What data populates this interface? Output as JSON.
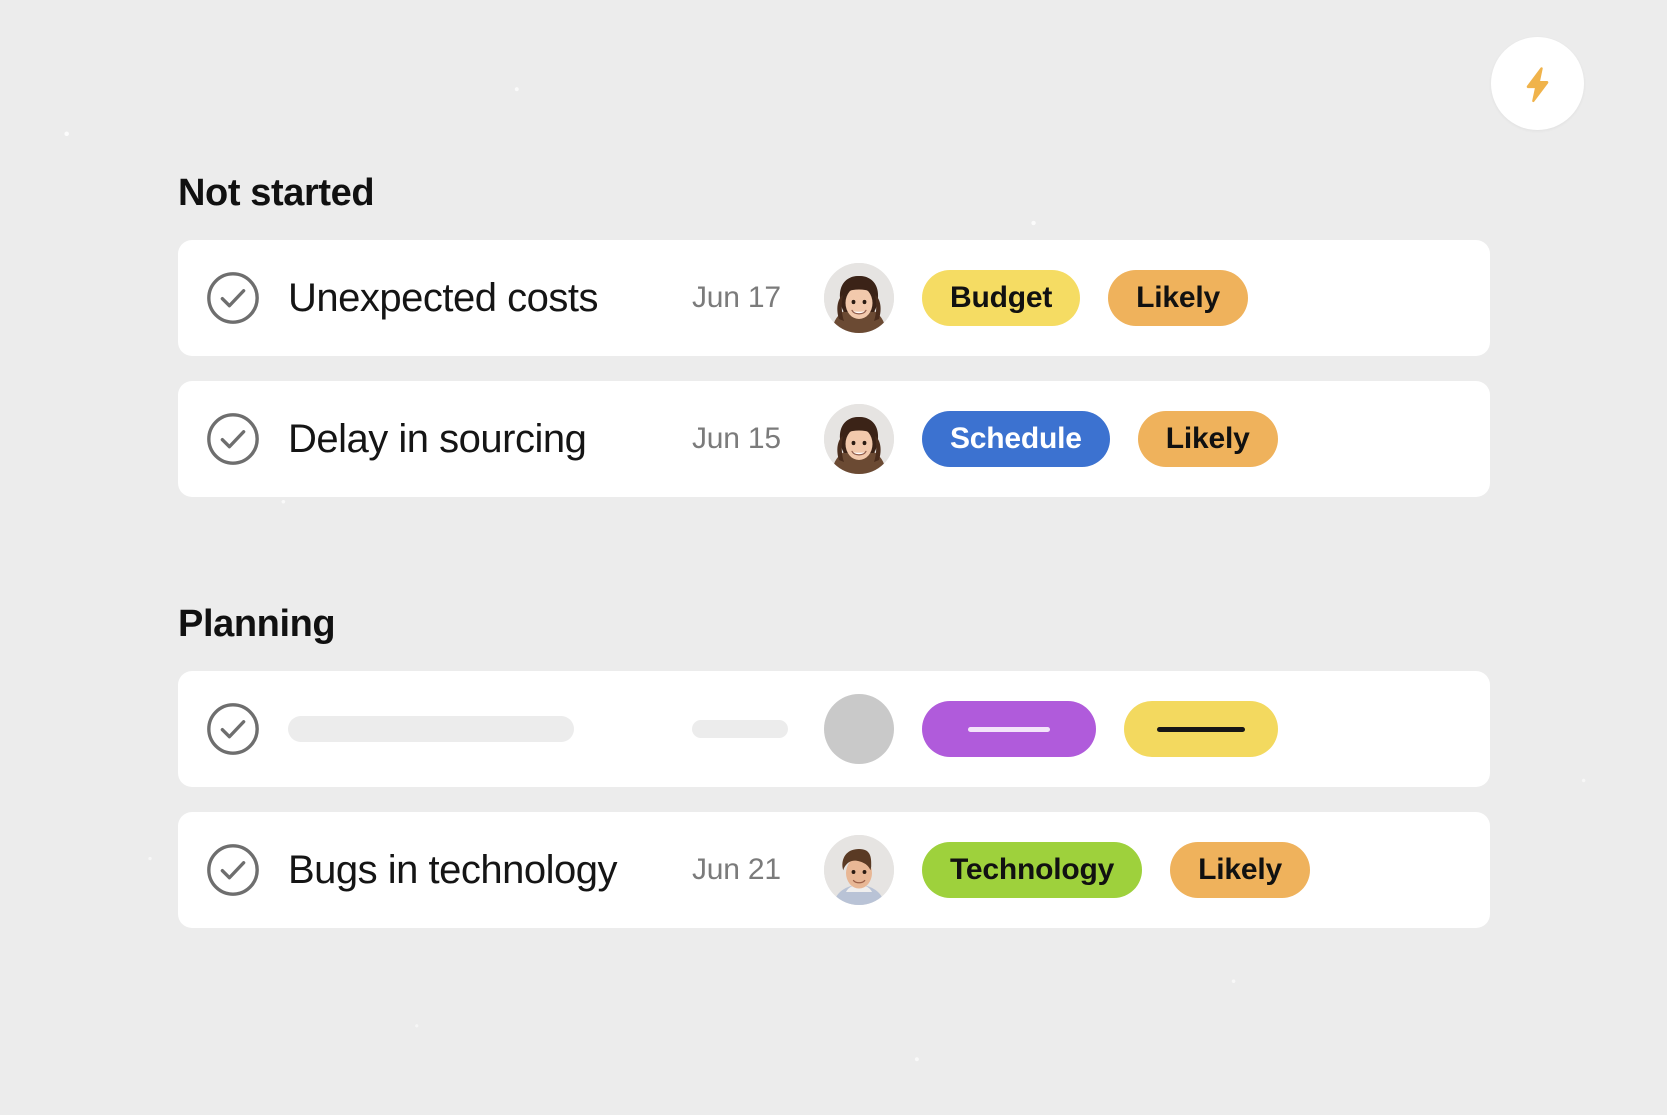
{
  "header": {
    "action_button": {
      "icon": "lightning-bolt-icon",
      "color": "#F0B34B"
    }
  },
  "colors": {
    "page_background": "#ECECEC",
    "card_background": "#FFFFFF",
    "title_text": "#151515",
    "date_text": "#7B7B7B",
    "check_icon": "#6E6E6E",
    "badge_budget": "#F5DC63",
    "badge_likely": "#EFB25C",
    "badge_schedule": "#3C72D0",
    "badge_technology": "#9ED13C",
    "badge_skeleton_purple": "#B05BDB",
    "badge_skeleton_yellow": "#F3D95F",
    "skeleton_gray": "#ECECEC",
    "skeleton_avatar": "#C9C9C9"
  },
  "groups": [
    {
      "title": "Not started",
      "rows": [
        {
          "checkbox": "unchecked",
          "title": "Unexpected costs",
          "date": "Jun 17",
          "avatar": "woman-brown-hair-avatar",
          "badges": [
            {
              "label": "Budget",
              "bg": "#F5DC63",
              "fg": "#111111"
            },
            {
              "label": "Likely",
              "bg": "#EFB25C",
              "fg": "#111111"
            }
          ]
        },
        {
          "checkbox": "unchecked",
          "title": "Delay in sourcing",
          "date": "Jun 15",
          "avatar": "woman-brown-hair-avatar",
          "badges": [
            {
              "label": "Schedule",
              "bg": "#3C72D0",
              "fg": "#FFFFFF"
            },
            {
              "label": "Likely",
              "bg": "#EFB25C",
              "fg": "#111111"
            }
          ]
        }
      ]
    },
    {
      "title": "Planning",
      "rows": [
        {
          "checkbox": "unchecked",
          "skeleton": true,
          "title": "",
          "date": "",
          "avatar": "placeholder-avatar",
          "badges": [
            {
              "label": "",
              "bg": "#B05BDB",
              "fg": "#FFFFFF"
            },
            {
              "label": "",
              "bg": "#F3D95F",
              "fg": "#111111"
            }
          ]
        },
        {
          "checkbox": "unchecked",
          "title": "Bugs in technology",
          "date": "Jun 21",
          "avatar": "man-brown-hair-avatar",
          "badges": [
            {
              "label": "Technology",
              "bg": "#9ED13C",
              "fg": "#111111"
            },
            {
              "label": "Likely",
              "bg": "#EFB25C",
              "fg": "#111111"
            }
          ]
        }
      ]
    }
  ]
}
